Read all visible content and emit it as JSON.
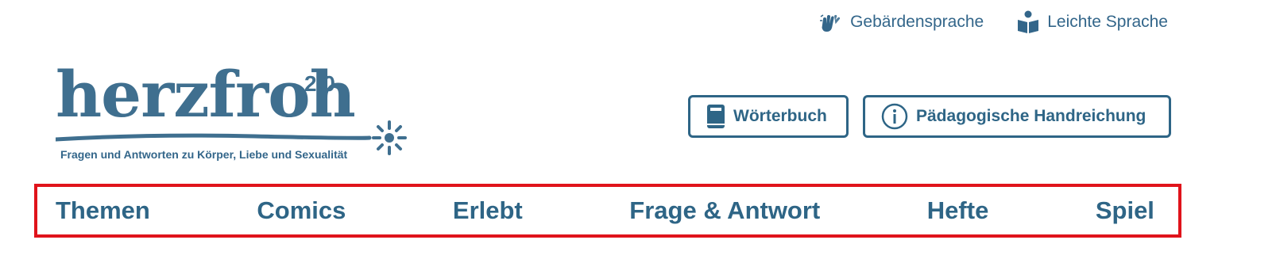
{
  "accessibility_links": [
    {
      "label": "Gebärdensprache",
      "icon": "sign-language-hands-icon"
    },
    {
      "label": "Leichte Sprache",
      "icon": "easy-language-reader-icon"
    }
  ],
  "logo": {
    "word": "herzfroh",
    "version": "2.0",
    "tagline": "Fragen und Antworten zu Körper, Liebe und Sexualität"
  },
  "header_buttons": [
    {
      "label": "Wörterbuch",
      "icon": "book-icon"
    },
    {
      "label": "Pädagogische Handreichung",
      "icon": "info-icon"
    }
  ],
  "nav": {
    "items": [
      "Themen",
      "Comics",
      "Erlebt",
      "Frage & Antwort",
      "Hefte",
      "Spiel"
    ],
    "highlight_color": "#e0131b"
  },
  "colors": {
    "brand": "#2e6586",
    "logo": "#3f6f8f",
    "background": "#ffffff"
  }
}
